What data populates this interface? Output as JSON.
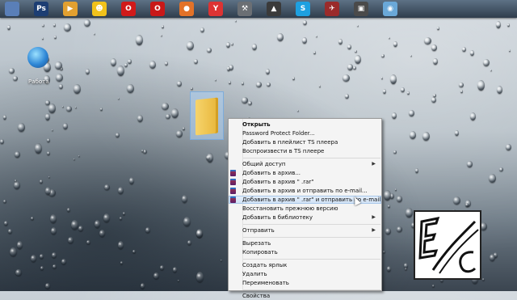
{
  "taskbar": {
    "icons": [
      {
        "name": "windows-icon",
        "glyph": "",
        "color": "#5a7fb8"
      },
      {
        "name": "photoshop-icon",
        "glyph": "Ps",
        "color": "#1d3e73"
      },
      {
        "name": "media-player-icon",
        "glyph": "▶",
        "color": "#e2a030"
      },
      {
        "name": "smiley-app-icon",
        "glyph": "☻",
        "color": "#f1c21b"
      },
      {
        "name": "opera-icon",
        "glyph": "O",
        "color": "#d01a1a"
      },
      {
        "name": "opera-alt-icon",
        "glyph": "O",
        "color": "#c81818"
      },
      {
        "name": "firefox-icon",
        "glyph": "●",
        "color": "#e37228"
      },
      {
        "name": "yandex-icon",
        "glyph": "Y",
        "color": "#d33"
      },
      {
        "name": "tool-app-icon",
        "glyph": "⚒",
        "color": "#6b6f74"
      },
      {
        "name": "triangle-app-icon",
        "glyph": "▲",
        "color": "#3a3a3a"
      },
      {
        "name": "skype-icon",
        "glyph": "S",
        "color": "#1ea0e0"
      },
      {
        "name": "wargame-app-icon",
        "glyph": "✈",
        "color": "#9a2b2b"
      },
      {
        "name": "tanks-app-icon",
        "glyph": "▣",
        "color": "#4a4a4a"
      },
      {
        "name": "disk-app-icon",
        "glyph": "◉",
        "color": "#6aa8d8"
      }
    ]
  },
  "desktop": {
    "network_label": "Работа"
  },
  "context_menu": {
    "items": [
      {
        "label": "Открыть",
        "bold": true,
        "icon": false,
        "submenu": false,
        "hover": false
      },
      {
        "label": "Password Protect Folder...",
        "bold": false,
        "icon": false,
        "submenu": false,
        "hover": false
      },
      {
        "label": "Добавить в плейлист TS плеера",
        "bold": false,
        "icon": false,
        "submenu": false,
        "hover": false
      },
      {
        "label": "Воспроизвести в TS плеере",
        "bold": false,
        "icon": false,
        "submenu": false,
        "hover": false
      },
      {
        "sep": true
      },
      {
        "label": "Общий доступ",
        "bold": false,
        "icon": false,
        "submenu": true,
        "hover": false
      },
      {
        "label": "Добавить в архив...",
        "bold": false,
        "icon": true,
        "submenu": false,
        "hover": false
      },
      {
        "label": "Добавить в архив \" .rar\"",
        "bold": false,
        "icon": true,
        "submenu": false,
        "hover": false
      },
      {
        "label": "Добавить в архив и отправить по e-mail...",
        "bold": false,
        "icon": true,
        "submenu": false,
        "hover": false
      },
      {
        "label": "Добавить в архив \" .rar\" и отправить по e-mail",
        "bold": false,
        "icon": true,
        "submenu": false,
        "hover": true
      },
      {
        "label": "Восстановить прежнюю версию",
        "bold": false,
        "icon": false,
        "submenu": false,
        "hover": false
      },
      {
        "label": "Добавить в библиотеку",
        "bold": false,
        "icon": false,
        "submenu": true,
        "hover": false
      },
      {
        "sep": true
      },
      {
        "label": "Отправить",
        "bold": false,
        "icon": false,
        "submenu": true,
        "hover": false
      },
      {
        "sep": true
      },
      {
        "label": "Вырезать",
        "bold": false,
        "icon": false,
        "submenu": false,
        "hover": false
      },
      {
        "label": "Копировать",
        "bold": false,
        "icon": false,
        "submenu": false,
        "hover": false
      },
      {
        "sep": true
      },
      {
        "label": "Создать ярлык",
        "bold": false,
        "icon": false,
        "submenu": false,
        "hover": false
      },
      {
        "label": "Удалить",
        "bold": false,
        "icon": false,
        "submenu": false,
        "hover": false
      },
      {
        "label": "Переименовать",
        "bold": false,
        "icon": false,
        "submenu": false,
        "hover": false
      },
      {
        "sep": true
      },
      {
        "label": "Свойства",
        "bold": false,
        "icon": false,
        "submenu": false,
        "hover": false
      }
    ]
  },
  "colors": {
    "menu_hover": "#cfe1f5",
    "rar_icon": "#7a2a5e"
  }
}
